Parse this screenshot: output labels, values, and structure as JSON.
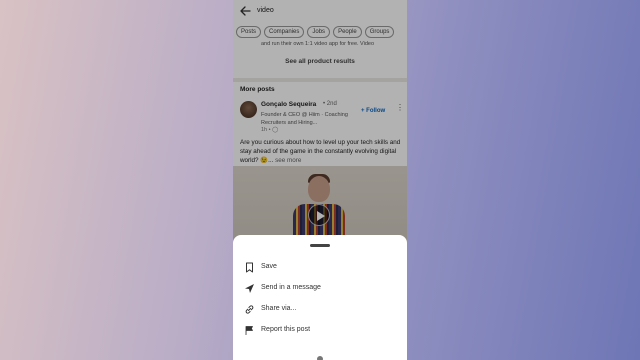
{
  "search": {
    "query": "video"
  },
  "filters": [
    "Posts",
    "Companies",
    "Jobs",
    "People",
    "Groups"
  ],
  "product_snippet": "and run their own 1:1 video app for free. Video",
  "see_all_label": "See all product results",
  "more_posts_heading": "More posts",
  "post": {
    "author": "Gonçalo Sequeira",
    "degree": "• 2nd",
    "headline": "Founder & CEO @ Hiim · Coaching Recruiters and Hiring...",
    "time": "1h •",
    "follow_label": "+ Follow",
    "text": "Are you curious about how to level up your tech skills and stay ahead of the game in the constantly evolving digital world? 😉...",
    "see_more": "see more"
  },
  "sheet": {
    "items": [
      {
        "label": "Save",
        "icon": "bookmark-icon"
      },
      {
        "label": "Send in a message",
        "icon": "send-icon"
      },
      {
        "label": "Share via...",
        "icon": "link-icon"
      },
      {
        "label": "Report this post",
        "icon": "flag-icon"
      }
    ]
  },
  "colors": {
    "follow": "#0a66c2",
    "dim_overlay": "rgba(0,0,0,0.30)"
  }
}
